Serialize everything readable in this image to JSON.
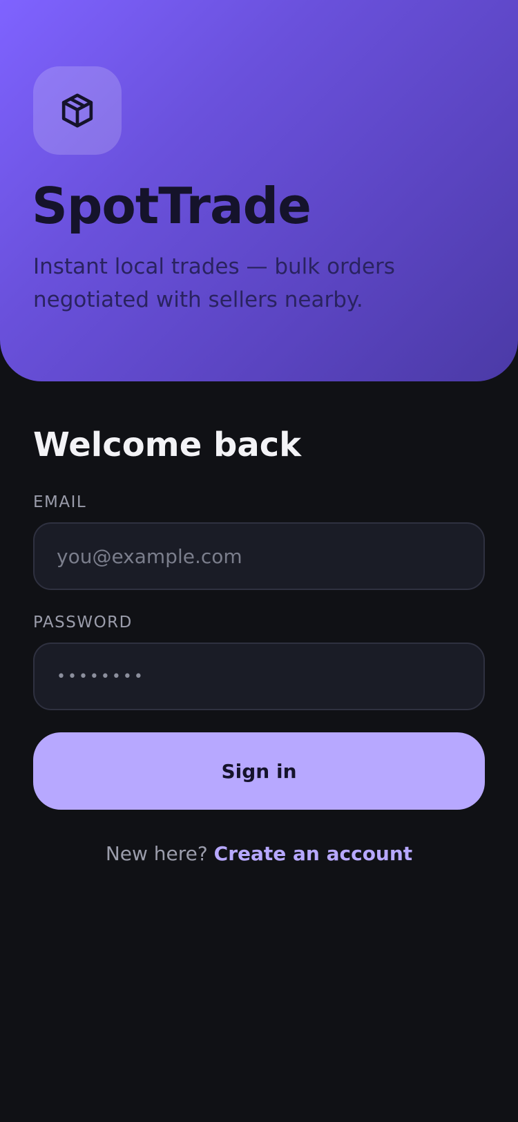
{
  "hero": {
    "brand": "SpotTrade",
    "tagline": "Instant local trades — bulk orders negotiated with sellers nearby.",
    "logo_icon": "package-box-icon",
    "gradient_start": "#7f63ff",
    "gradient_end": "#4b3aa6"
  },
  "form": {
    "title": "Welcome back",
    "email": {
      "label": "EMAIL",
      "placeholder": "you@example.com",
      "value": ""
    },
    "password": {
      "label": "PASSWORD",
      "value": "••••••••"
    },
    "submit_label": "Sign in"
  },
  "footer": {
    "prompt": "New here?",
    "link_label": "Create an account"
  },
  "colors": {
    "background": "#101115",
    "accent": "#b7a8ff",
    "input_bg": "#1a1c26"
  }
}
